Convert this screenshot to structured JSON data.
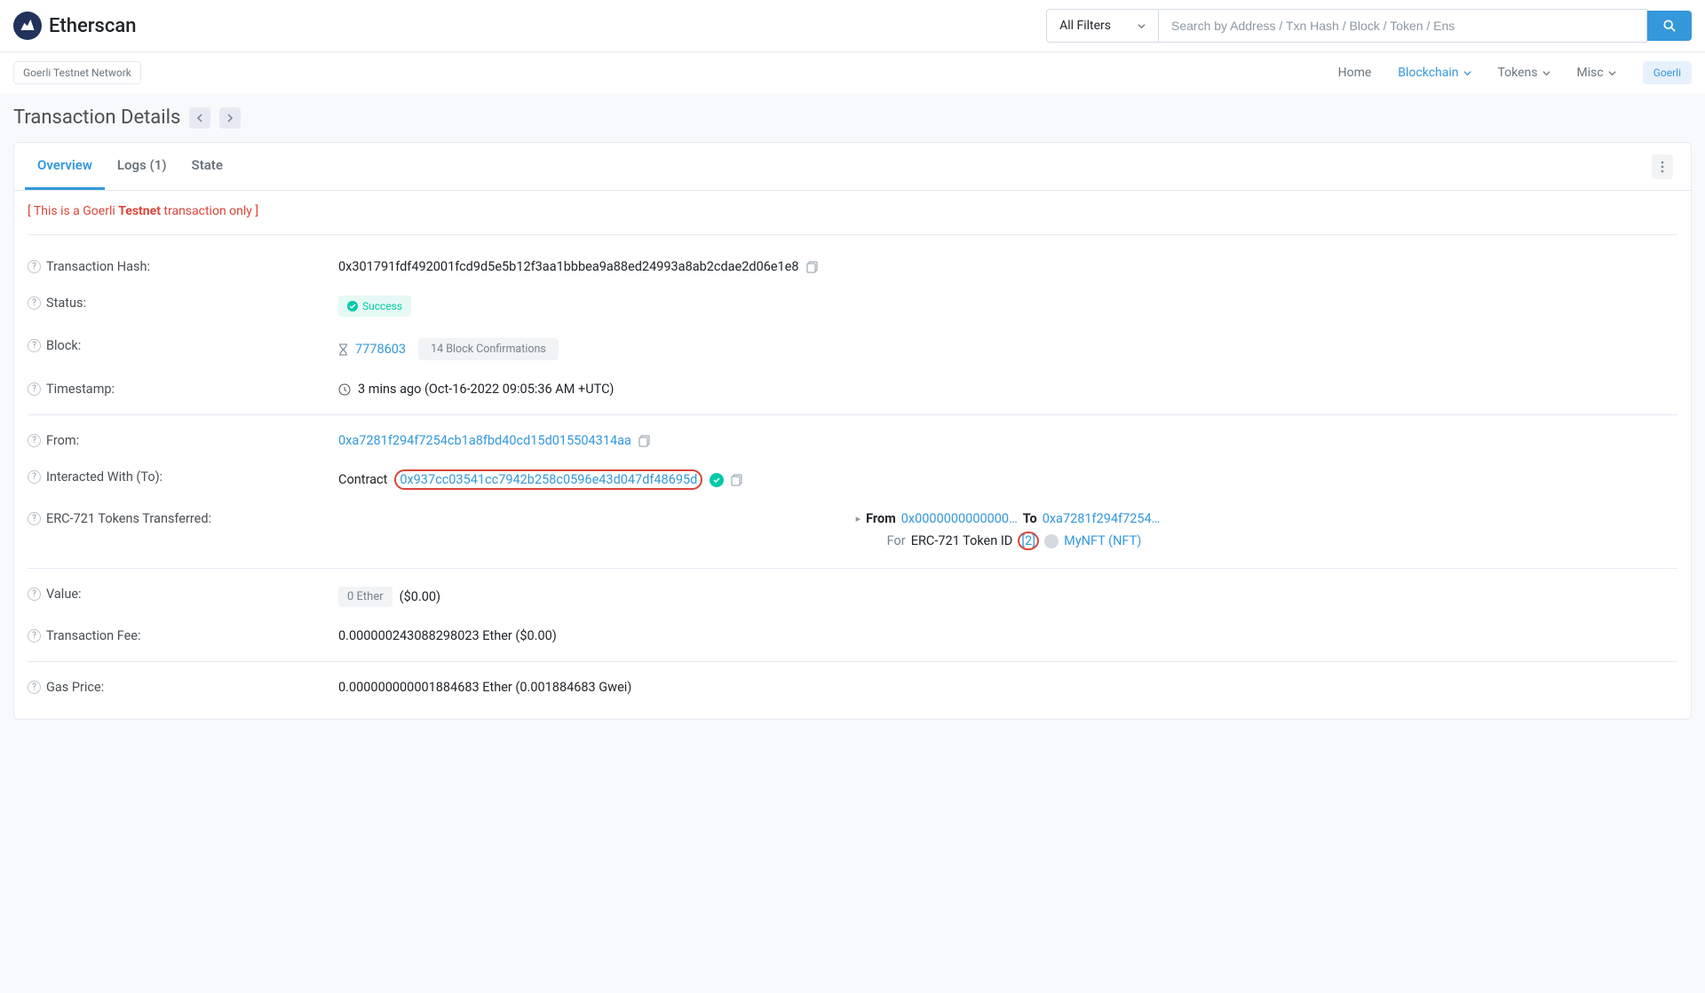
{
  "header": {
    "logo_text": "Etherscan",
    "filter_label": "All Filters",
    "search_placeholder": "Search by Address / Txn Hash / Block / Token / Ens",
    "network_label": "Goerli Testnet Network",
    "nav": {
      "home": "Home",
      "blockchain": "Blockchain",
      "tokens": "Tokens",
      "misc": "Misc"
    },
    "goerli_badge": "Goerli"
  },
  "page": {
    "title": "Transaction Details",
    "tabs": {
      "overview": "Overview",
      "logs": "Logs (1)",
      "state": "State"
    },
    "warning_prefix": "[ This is a Goerli ",
    "warning_bold": "Testnet",
    "warning_suffix": " transaction only ]"
  },
  "labels": {
    "tx_hash": "Transaction Hash:",
    "status": "Status:",
    "block": "Block:",
    "timestamp": "Timestamp:",
    "from": "From:",
    "to": "Interacted With (To):",
    "erc721": "ERC-721 Tokens Transferred:",
    "value": "Value:",
    "fee": "Transaction Fee:",
    "gas": "Gas Price:"
  },
  "values": {
    "tx_hash": "0x301791fdf492001fcd9d5e5b12f3aa1bbbea9a88ed24993a8ab2cdae2d06e1e8",
    "status": "Success",
    "block": "7778603",
    "confirmations": "14 Block Confirmations",
    "timestamp": "3 mins ago (Oct-16-2022 09:05:36 AM +UTC)",
    "from": "0xa7281f294f7254cb1a8fbd40cd15d015504314aa",
    "to_prefix": "Contract",
    "to_addr": "0x937cc03541cc7942b258c0596e43d047df48695d",
    "transfer_from_label": "From",
    "transfer_from": "0x0000000000000…",
    "transfer_to_label": "To",
    "transfer_to": "0xa7281f294f7254…",
    "transfer_line2_prefix": "For",
    "transfer_tokenid_label": "ERC-721 Token ID",
    "transfer_tokenid": "[2]",
    "transfer_token_name": "MyNFT (NFT)",
    "value_badge": "0 Ether",
    "value_usd": "($0.00)",
    "fee": "0.000000243088298023 Ether ($0.00)",
    "gas": "0.000000000001884683 Ether (0.001884683 Gwei)"
  }
}
